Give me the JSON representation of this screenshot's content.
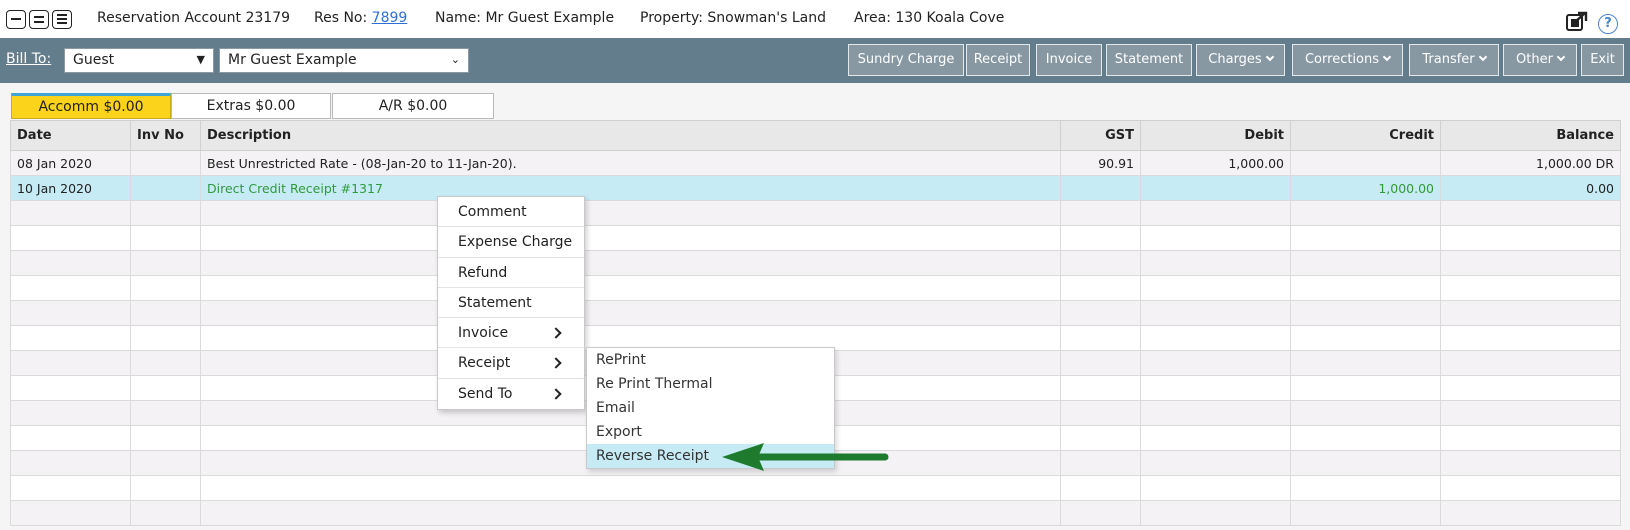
{
  "header": {
    "title": "Reservation Account 23179",
    "res_no_label": "Res No:",
    "res_no_value": "7899",
    "name": "Name: Mr Guest Example",
    "property": "Property: Snowman's Land",
    "area": "Area: 130 Koala Cove",
    "help_glyph": "?"
  },
  "toolbar": {
    "bill_to_label": "Bill To:",
    "bill_to_value": "Guest",
    "guest_value": "Mr Guest Example",
    "buttons": {
      "sundry": "Sundry Charge",
      "receipt": "Receipt",
      "invoice": "Invoice",
      "statement": "Statement",
      "charges": "Charges",
      "corrections": "Corrections",
      "transfer": "Transfer",
      "other": "Other",
      "exit": "Exit"
    }
  },
  "tabs": {
    "accomm": "Accomm $0.00",
    "extras": "Extras $0.00",
    "ar": "A/R $0.00"
  },
  "table": {
    "columns": [
      "Date",
      "Inv No",
      "Description",
      "GST",
      "Debit",
      "Credit",
      "Balance"
    ],
    "rows": [
      {
        "date": "08 Jan 2020",
        "inv_no": "",
        "description": "Best Unrestricted Rate - (08-Jan-20 to 11-Jan-20).",
        "gst": "90.91",
        "debit": "1,000.00",
        "credit": "",
        "balance": "1,000.00 DR"
      },
      {
        "date": "10 Jan 2020",
        "inv_no": "",
        "description": "Direct Credit Receipt #1317",
        "gst": "",
        "debit": "",
        "credit": "1,000.00",
        "balance": "0.00"
      }
    ]
  },
  "context_menu": {
    "items": [
      "Comment",
      "Expense Charge",
      "Refund",
      "Statement",
      "Invoice",
      "Receipt",
      "Send To"
    ]
  },
  "receipt_submenu": {
    "items": [
      "RePrint",
      "Re Print Thermal",
      "Email",
      "Export",
      "Reverse Receipt"
    ]
  },
  "colors": {
    "toolbar_bg": "#647d8c",
    "active_tab": "#fbd31b",
    "selected_row": "#c7ebf5",
    "credit_text": "#2f9a3d",
    "annotation_arrow": "#1e7a2c"
  }
}
